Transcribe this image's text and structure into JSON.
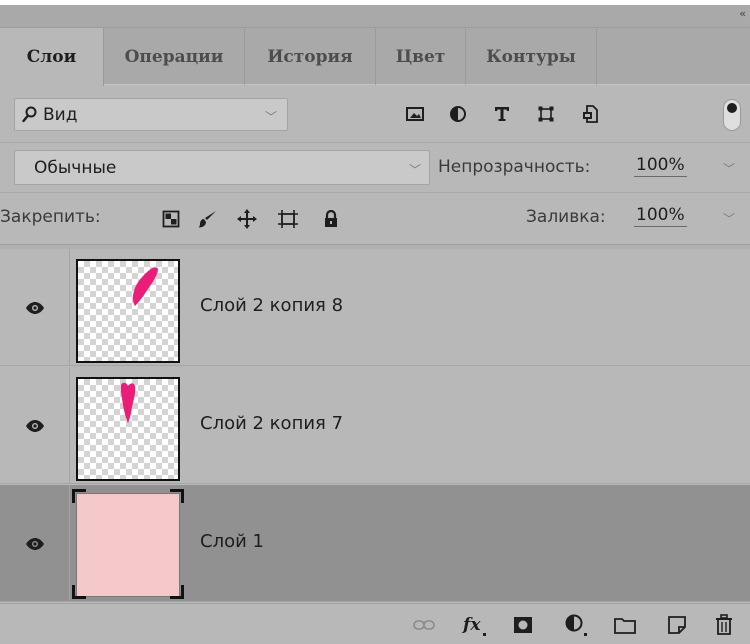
{
  "collapse_icon": "double-chevron-icon",
  "tabs": [
    {
      "label": "Слои",
      "active": true
    },
    {
      "label": "Операции",
      "active": false
    },
    {
      "label": "История",
      "active": false
    },
    {
      "label": "Цвет",
      "active": false
    },
    {
      "label": "Контуры",
      "active": false
    }
  ],
  "filter": {
    "kind_label": "Вид",
    "icons": [
      "image-filter-icon",
      "adjustment-filter-icon",
      "type-filter-icon",
      "shape-filter-icon",
      "smart-object-filter-icon"
    ],
    "toggle_on": true
  },
  "blend": {
    "mode": "Обычные",
    "opacity_label": "Непрозрачность:",
    "opacity_value": "100%"
  },
  "lock": {
    "label": "Закрепить:",
    "icons": [
      "lock-transparent-icon",
      "lock-brush-icon",
      "lock-move-icon",
      "lock-artboard-icon",
      "lock-all-icon"
    ],
    "fill_label": "Заливка:",
    "fill_value": "100%"
  },
  "layers": [
    {
      "name": "Слой 2 копия 8",
      "visible": true,
      "selected": false,
      "thumb": "petal-tilted"
    },
    {
      "name": "Слой 2 копия 7",
      "visible": true,
      "selected": false,
      "thumb": "petal-vertical"
    },
    {
      "name": "Слой 1",
      "visible": true,
      "selected": true,
      "thumb": "solid-pink"
    }
  ],
  "colors": {
    "panel_bg": "#b8b8b8",
    "selected_row": "#919191",
    "petal": "#ea1e78",
    "fill_pink": "#f4c8c8"
  },
  "bottom_icons": [
    "link-layers-icon",
    "fx-icon",
    "layer-mask-icon",
    "adjustment-layer-icon",
    "group-folder-icon",
    "new-layer-icon",
    "trash-icon"
  ]
}
